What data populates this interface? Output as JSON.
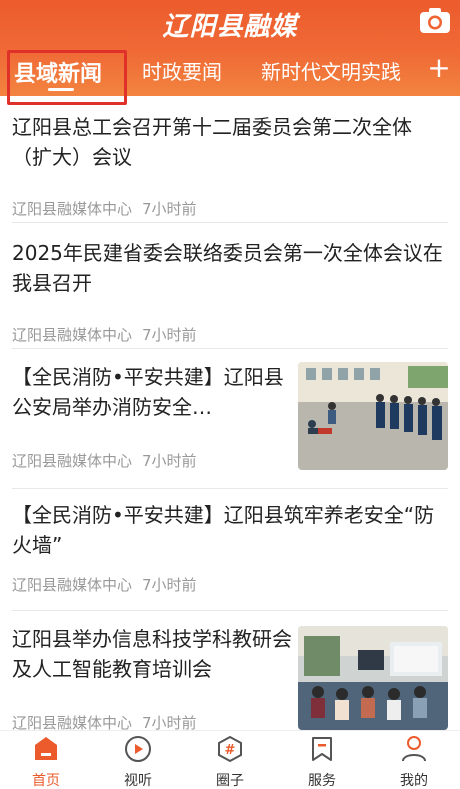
{
  "header": {
    "logo": "辽阳县融媒",
    "camera_icon": "camera-icon",
    "tabs": [
      {
        "label": "县域新闻",
        "active": true
      },
      {
        "label": "时政要闻",
        "active": false
      },
      {
        "label": "新时代文明实践",
        "active": false
      }
    ],
    "add_icon": "plus-icon",
    "brand_color": "#ec5b2c"
  },
  "feed": [
    {
      "title": "辽阳县总工会召开第十二届委员会第二次全体（扩大）会议",
      "source": "辽阳县融媒体中心",
      "time": "7小时前",
      "thumb": null
    },
    {
      "title": "2025年民建省委会联络委员会第一次全体会议在我县召开",
      "source": "辽阳县融媒体中心",
      "time": "7小时前",
      "thumb": null
    },
    {
      "title": "【全民消防•平安共建】辽阳县公安局举办消防安全…",
      "source": "辽阳县融媒体中心",
      "time": "7小时前",
      "thumb": "fire-drill-photo"
    },
    {
      "title": "【全民消防•平安共建】辽阳县筑牢养老安全“防火墙”",
      "source": "辽阳县融媒体中心",
      "time": "7小时前",
      "thumb": null
    },
    {
      "title": "辽阳县举办信息科技学科教研会及人工智能教育培训会",
      "source": "辽阳县融媒体中心",
      "time": "7小时前",
      "thumb": "classroom-training-photo"
    }
  ],
  "bottom_nav": [
    {
      "label": "首页",
      "icon": "home-icon",
      "active": true
    },
    {
      "label": "视听",
      "icon": "play-icon",
      "active": false
    },
    {
      "label": "圈子",
      "icon": "hashtag-icon",
      "active": false
    },
    {
      "label": "服务",
      "icon": "bookmark-icon",
      "active": false
    },
    {
      "label": "我的",
      "icon": "user-icon",
      "active": false
    }
  ]
}
